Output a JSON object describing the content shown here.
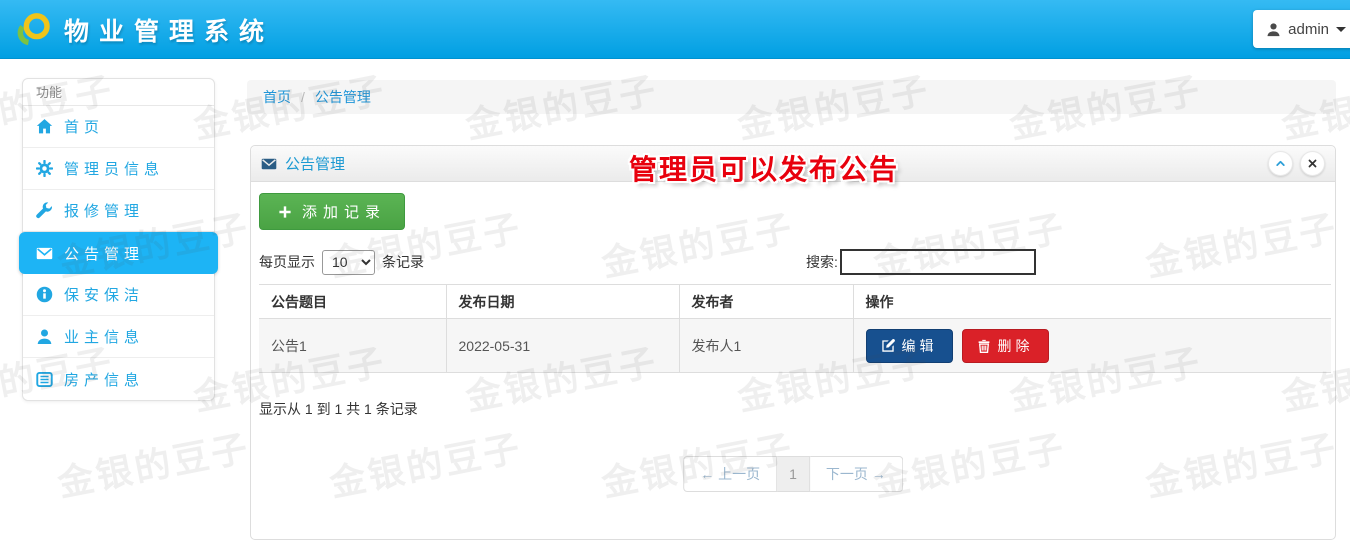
{
  "header": {
    "app_title": "物业管理系统",
    "user_name": "admin",
    "user_icon": "user-icon",
    "logo_icon": "logo-icon"
  },
  "sidebar": {
    "section_title": "功能",
    "items": [
      {
        "label": "首页",
        "icon": "home",
        "active": false
      },
      {
        "label": "管理员信息",
        "icon": "gear",
        "active": false
      },
      {
        "label": "报修管理",
        "icon": "wrench",
        "active": false
      },
      {
        "label": "公告管理",
        "icon": "envelope",
        "active": true
      },
      {
        "label": "保安保洁",
        "icon": "info",
        "active": false
      },
      {
        "label": "业主信息",
        "icon": "user",
        "active": false
      },
      {
        "label": "房产信息",
        "icon": "building",
        "active": false
      }
    ]
  },
  "breadcrumb": {
    "home": "首页",
    "separator": "/",
    "current": "公告管理"
  },
  "panel": {
    "title": "公告管理",
    "title_icon": "envelope-icon",
    "annotation": "管理员可以发布公告",
    "collapse_icon": "chevron-up-icon",
    "close_icon": "close-icon",
    "add_record_label": "添加记录",
    "add_record_icon": "plus-icon",
    "page_size_prefix": "每页显示",
    "page_size_value": "10",
    "page_size_suffix": "条记录",
    "search_label": "搜索:",
    "search_value": "",
    "table": {
      "columns": [
        "公告题目",
        "发布日期",
        "发布者",
        "操作"
      ],
      "rows": [
        {
          "title": "公告1",
          "date": "2022-05-31",
          "publisher": "发布人1"
        }
      ],
      "edit_label": "编辑",
      "edit_icon": "edit-icon",
      "delete_label": "删除",
      "delete_icon": "trash-icon"
    },
    "summary": "显示从 1 到 1 共 1 条记录",
    "pagination": {
      "prev": "← 上一页",
      "page": "1",
      "next": "下一页 →"
    }
  },
  "watermark": {
    "text": "金银的豆子"
  },
  "colors": {
    "accent": "#1db4f5",
    "link": "#2196d8",
    "green": "#5bb454",
    "navy": "#17508f",
    "red": "#da2128",
    "annotation": "#e8000d",
    "header_top": "#35baf3",
    "header_bottom": "#009fe2"
  }
}
